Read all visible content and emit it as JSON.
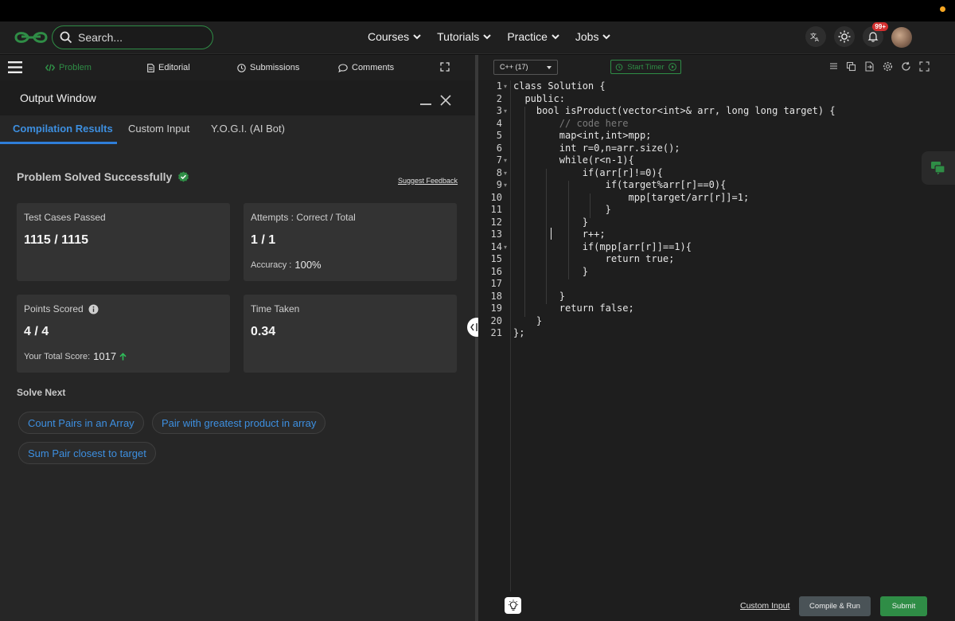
{
  "navbar": {
    "search_placeholder": "Search...",
    "menu": [
      {
        "label": "Courses",
        "icon": "chevron-down-icon"
      },
      {
        "label": "Tutorials",
        "icon": "chevron-down-icon"
      },
      {
        "label": "Practice",
        "icon": "chevron-down-icon"
      },
      {
        "label": "Jobs",
        "icon": "chevron-down-icon"
      }
    ],
    "notification_count": "99+",
    "brand_color": "#2f8d46"
  },
  "left_toolbar": {
    "problem": "Problem",
    "editorial": "Editorial",
    "submissions": "Submissions",
    "comments": "Comments"
  },
  "output_window": {
    "title": "Output Window",
    "tabs": [
      "Compilation Results",
      "Custom Input",
      "Y.O.G.I. (AI Bot)"
    ],
    "status": "Problem Solved Successfully",
    "suggest_feedback": "Suggest Feedback",
    "cards": {
      "test_cases": {
        "label": "Test Cases Passed",
        "value": "1115 / 1115"
      },
      "attempts": {
        "label": "Attempts : Correct / Total",
        "value": "1 / 1",
        "sub_label": "Accuracy :",
        "sub_value": "100%"
      },
      "points": {
        "label": "Points Scored",
        "value": "4 / 4",
        "sub_label": "Your Total Score:",
        "sub_value": "1017"
      },
      "time": {
        "label": "Time Taken",
        "value": "0.34"
      }
    },
    "solve_next_title": "Solve Next",
    "solve_next": [
      "Count Pairs in an Array",
      "Pair with greatest product in array",
      "Sum Pair closest to target"
    ]
  },
  "editor": {
    "language": "C++ (17)",
    "timer_label": "Start Timer",
    "line_numbers": [
      "1",
      "2",
      "3",
      "4",
      "5",
      "6",
      "7",
      "8",
      "9",
      "10",
      "11",
      "12",
      "13",
      "14",
      "15",
      "16",
      "17",
      "18",
      "19",
      "20",
      "21"
    ],
    "code": [
      "class Solution {",
      "  public:",
      "    bool isProduct(vector<int>& arr, long long target) {",
      "        // code here",
      "        map<int,int>mpp;",
      "        int r=0,n=arr.size();",
      "        while(r<n-1){",
      "            if(arr[r]!=0){",
      "                if(target%arr[r]==0){",
      "                    mpp[target/arr[r]]=1;",
      "                }",
      "            }",
      "            r++;",
      "            if(mpp[arr[r]]==1){",
      "                return true;",
      "            }",
      "",
      "        }",
      "        return false;",
      "    }",
      "};"
    ]
  },
  "bottom_bar": {
    "custom_input": "Custom Input",
    "compile_run": "Compile & Run",
    "submit": "Submit"
  }
}
